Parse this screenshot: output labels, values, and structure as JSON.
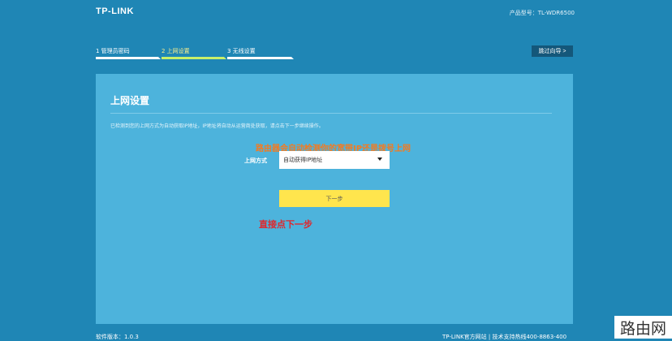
{
  "header": {
    "logo": "TP-LINK",
    "model": "产品型号：TL-WDR6500"
  },
  "steps": [
    {
      "label": "1 管理员密码",
      "active": false
    },
    {
      "label": "2 上网设置",
      "active": true
    },
    {
      "label": "3 无线设置",
      "active": false
    }
  ],
  "skip_button": "跳过向导 >",
  "panel": {
    "title": "上网设置",
    "description": "已检测到您的上网方式为自动获取IP地址，IP地址将自动从运营商处获取，请点击下一步继续操作。",
    "connection_label": "上网方式",
    "connection_value": "自动获得IP地址",
    "next_button": "下一步"
  },
  "annotations": {
    "orange": "路由器会自动检测你的宽带IP还是拨号上网",
    "red": "直接点下一步"
  },
  "footer": {
    "left": "软件版本：1.0.3",
    "right": "TP-LINK官方网站  |  技术支持热线400-8863-400"
  },
  "watermark": "路由网",
  "colors": {
    "background": "#1f86b5",
    "panel": "#4db3dc",
    "active_step": "#c8f06a",
    "next_button": "#ffe54d",
    "annotation_orange": "#f47a20",
    "annotation_red": "#e0262c"
  }
}
